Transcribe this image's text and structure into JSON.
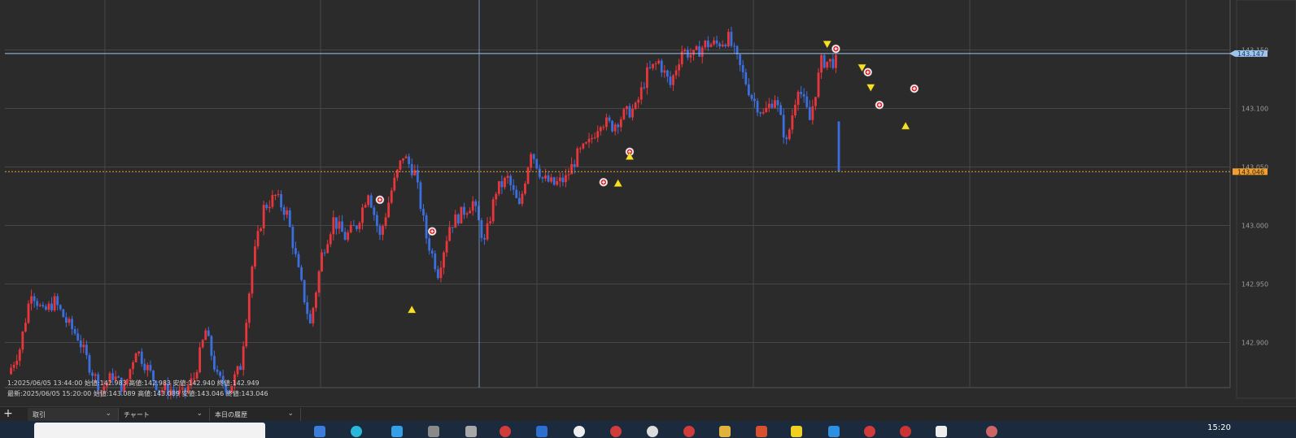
{
  "chart_data": {
    "type": "candlestick",
    "y_ticks": [
      "143.150",
      "143.100",
      "143.050",
      "143.000",
      "142.950",
      "142.900"
    ],
    "ylim": [
      142.862,
      143.192
    ],
    "current_price_label": "143.147",
    "last_price_label": "143.046",
    "hover_info": "1:2025/06/05 13:44:00  始値:142.983  高値:142.983  安値:142.940  終値:142.949",
    "latest_info": "最新:2025/06/05 15:20:00  始値:143.089  高値:143.089  安値:143.046  終値:143.046",
    "colors": {
      "up": "#e8363c",
      "down": "#3b6fe0",
      "grid": "#474747",
      "background": "#2b2b2b",
      "current_line": "#9ec4ea",
      "last_line": "#f0a030",
      "marker_triangle": "#f5e12a"
    },
    "candle_count": 168,
    "anchors": [
      [
        0,
        142.873
      ],
      [
        4,
        142.895
      ],
      [
        8,
        142.945
      ],
      [
        12,
        142.925
      ],
      [
        16,
        142.935
      ],
      [
        20,
        142.918
      ],
      [
        24,
        142.905
      ],
      [
        28,
        142.88
      ],
      [
        32,
        142.86
      ],
      [
        36,
        142.872
      ],
      [
        40,
        142.86
      ],
      [
        44,
        142.895
      ],
      [
        48,
        142.878
      ],
      [
        52,
        142.86
      ],
      [
        56,
        142.86
      ],
      [
        60,
        142.855
      ],
      [
        64,
        142.87
      ],
      [
        68,
        142.91
      ],
      [
        72,
        142.87
      ],
      [
        76,
        142.86
      ],
      [
        80,
        142.88
      ],
      [
        84,
        142.965
      ],
      [
        88,
        143.015
      ],
      [
        92,
        143.025
      ],
      [
        96,
        143.01
      ],
      [
        100,
        142.96
      ],
      [
        104,
        142.915
      ],
      [
        108,
        142.975
      ],
      [
        112,
        143.005
      ],
      [
        116,
        142.99
      ],
      [
        120,
        143.0
      ],
      [
        124,
        143.03
      ],
      [
        128,
        142.99
      ],
      [
        132,
        143.03
      ],
      [
        136,
        143.06
      ],
      [
        140,
        143.045
      ],
      [
        144,
        142.99
      ],
      [
        148,
        142.96
      ],
      [
        152,
        143.0
      ],
      [
        156,
        143.01
      ],
      [
        160,
        143.02
      ],
      [
        164,
        142.985
      ],
      [
        168,
        143.03
      ],
      [
        172,
        143.04
      ],
      [
        176,
        143.015
      ],
      [
        180,
        143.065
      ],
      [
        184,
        143.04
      ],
      [
        188,
        143.035
      ],
      [
        192,
        143.04
      ],
      [
        196,
        143.06
      ],
      [
        200,
        143.07
      ],
      [
        204,
        143.09
      ],
      [
        208,
        143.085
      ],
      [
        212,
        143.095
      ],
      [
        216,
        143.1
      ],
      [
        220,
        143.13
      ],
      [
        224,
        143.14
      ],
      [
        228,
        143.12
      ],
      [
        232,
        143.15
      ],
      [
        236,
        143.145
      ],
      [
        240,
        143.155
      ],
      [
        244,
        143.155
      ],
      [
        248,
        143.16
      ],
      [
        252,
        143.135
      ],
      [
        256,
        143.11
      ],
      [
        260,
        143.095
      ],
      [
        264,
        143.11
      ],
      [
        268,
        143.07
      ],
      [
        272,
        143.12
      ],
      [
        276,
        143.09
      ],
      [
        280,
        143.14
      ],
      [
        284,
        143.14
      ]
    ],
    "markers": [
      {
        "type": "close-plus",
        "i": 128,
        "price": 143.022
      },
      {
        "type": "close-plus",
        "i": 146,
        "price": 142.995
      },
      {
        "type": "triangle-up",
        "i": 139,
        "price": 142.928
      },
      {
        "type": "close-plus",
        "i": 205,
        "price": 143.037
      },
      {
        "type": "close-plus",
        "i": 214,
        "price": 143.063
      },
      {
        "type": "triangle-up",
        "i": 214,
        "price": 143.059
      },
      {
        "type": "triangle-up",
        "i": 210,
        "price": 143.036
      },
      {
        "type": "triangle-down",
        "i": 282,
        "price": 143.155
      },
      {
        "type": "close-plus",
        "i": 285,
        "price": 143.151
      },
      {
        "type": "triangle-down",
        "i": 294,
        "price": 143.135
      },
      {
        "type": "close-plus",
        "i": 296,
        "price": 143.131
      },
      {
        "type": "triangle-down",
        "i": 297,
        "price": 143.118
      },
      {
        "type": "close-plus",
        "i": 300,
        "price": 143.103
      },
      {
        "type": "triangle-up",
        "i": 309,
        "price": 143.085
      },
      {
        "type": "close-plus",
        "i": 312,
        "price": 143.117
      }
    ]
  },
  "tabs": [
    {
      "label": "取引"
    },
    {
      "label": "チャート"
    },
    {
      "label": "本日の履歴"
    }
  ],
  "taskbar": {
    "clock": "15:20"
  }
}
